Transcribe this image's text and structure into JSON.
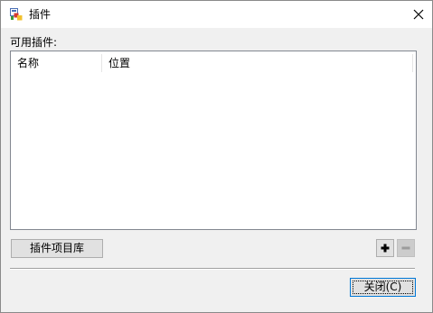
{
  "window": {
    "title": "插件",
    "close_glyph": "✕"
  },
  "plugins": {
    "section_label": "可用插件:",
    "columns": [
      {
        "label": "名称"
      },
      {
        "label": "位置"
      }
    ],
    "rows": []
  },
  "actions": {
    "gallery_label": "插件项目库",
    "add_icon": "plus-icon",
    "remove_icon": "minus-icon",
    "remove_enabled": false,
    "close_label": "关闭(C)"
  },
  "colors": {
    "focus_border": "#0078d7",
    "button_face": "#e1e1e1"
  }
}
